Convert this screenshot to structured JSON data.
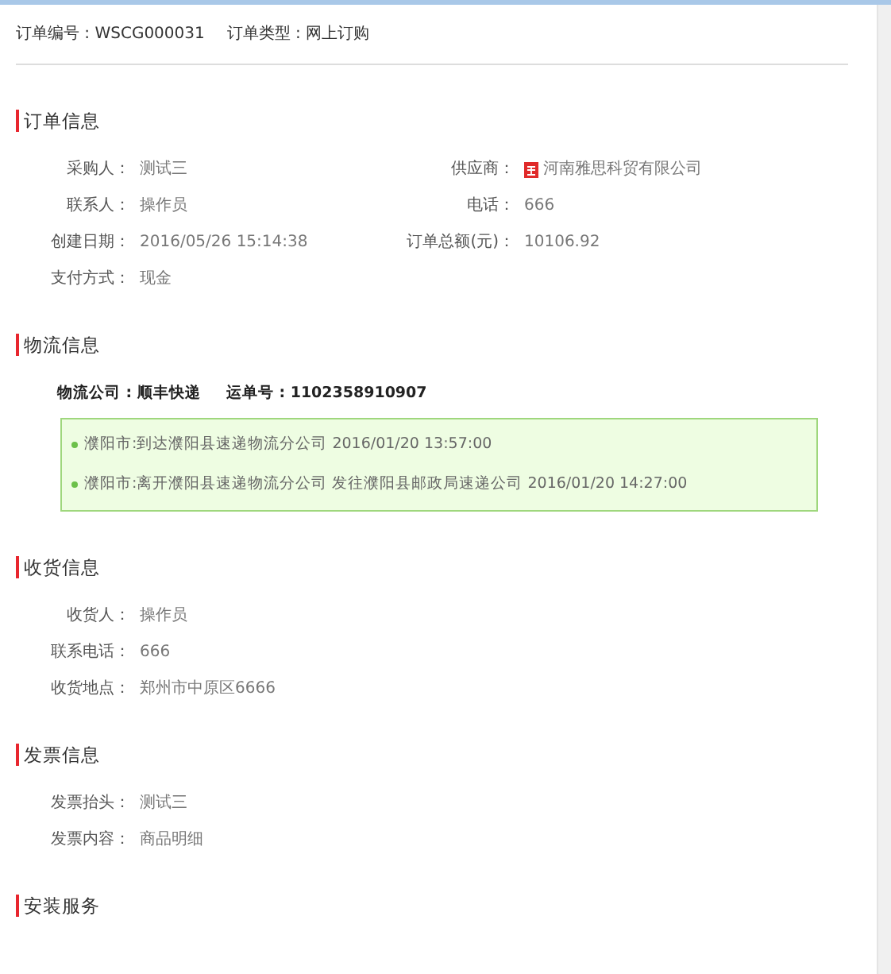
{
  "header": {
    "order_no_label": "订单编号 :",
    "order_no": "WSCG000031",
    "order_type_label": "订单类型 :",
    "order_type": "网上订购"
  },
  "order_info": {
    "title": "订单信息",
    "rows": [
      {
        "label": "采购人：",
        "value": "测试三",
        "right_label": "供应商：",
        "right_value": "河南雅思科贸有限公司",
        "kind": "shop"
      },
      {
        "label": "联系人：",
        "value": "操作员",
        "right_label": "电话：",
        "right_value": "666",
        "kind": "text"
      },
      {
        "label": "创建日期：",
        "value": "2016/05/26 15:14:38",
        "right_label": "订单总额(元)：",
        "right_value": "10106.92",
        "kind": "text"
      },
      {
        "label": "支付方式：",
        "value": "现金"
      }
    ]
  },
  "logistics": {
    "title": "物流信息",
    "company_label": "物流公司 :",
    "company": "顺丰快递",
    "waybill_label": "运单号 :",
    "waybill": "1102358910907",
    "events": [
      {
        "text": "濮阳市:到达濮阳县速递物流分公司",
        "time": "2016/01/20 13:57:00"
      },
      {
        "text": "濮阳市:离开濮阳县速递物流分公司 发往濮阳县邮政局速递公司",
        "time": "2016/01/20 14:27:00"
      }
    ]
  },
  "delivery_info": {
    "title": "收货信息",
    "rows": [
      {
        "label": "收货人：",
        "value": "操作员"
      },
      {
        "label": "联系电话：",
        "value": "666"
      },
      {
        "label": "收货地点：",
        "value": "郑州市中原区6666"
      }
    ]
  },
  "invoice_info": {
    "title": "发票信息",
    "rows": [
      {
        "label": "发票抬头：",
        "value": "测试三"
      },
      {
        "label": "发票内容：",
        "value": "商品明细"
      }
    ]
  },
  "install_service": {
    "title": "安装服务"
  }
}
